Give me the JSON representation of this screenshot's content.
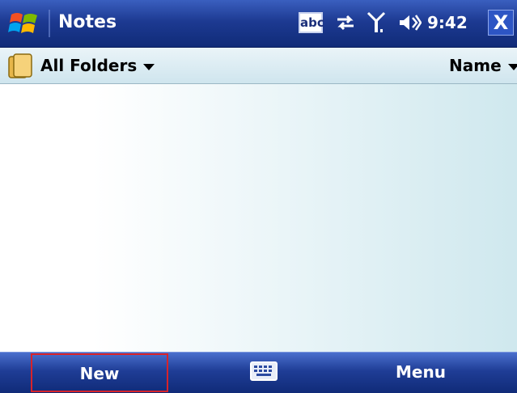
{
  "titlebar": {
    "title": "Notes",
    "ime_label": "abc",
    "time": "9:42",
    "close_label": "X"
  },
  "folderbar": {
    "folder_label": "All Folders",
    "sort_label": "Name"
  },
  "softkeys": {
    "left": "New",
    "right": "Menu"
  },
  "colors": {
    "titlebar": "#1d3a92",
    "folderbar": "#d9ecf3",
    "highlight": "#d8232a"
  },
  "icons": [
    "windows-start-icon",
    "abc-input-icon",
    "sync-icon",
    "signal-icon",
    "volume-icon",
    "close-icon",
    "folder-icon",
    "keyboard-icon"
  ]
}
